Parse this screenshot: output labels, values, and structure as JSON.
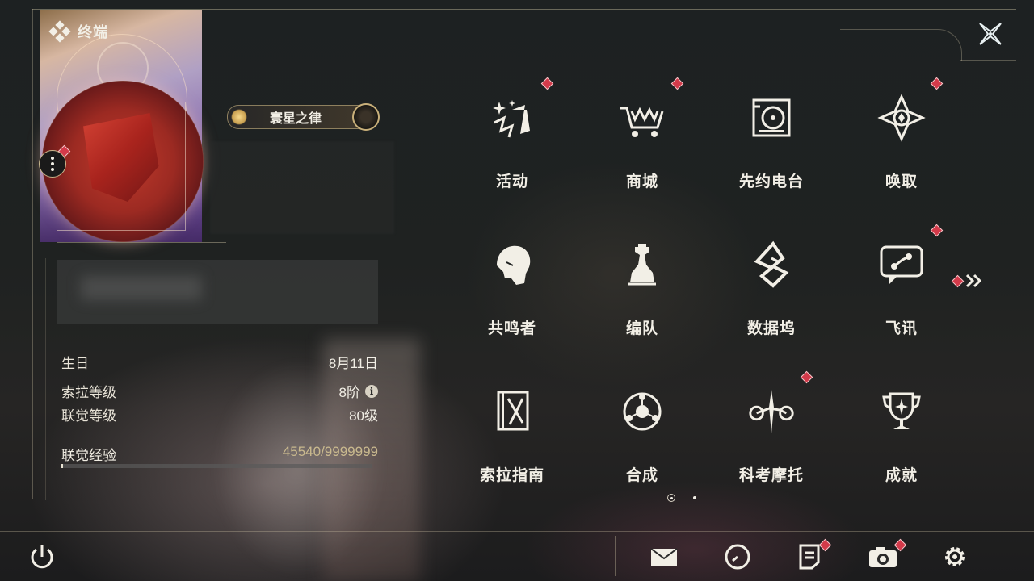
{
  "header": {
    "title": "终端"
  },
  "profile": {
    "title_badge": "寰星之律",
    "stats": [
      {
        "key": "生日",
        "value": "8月11日"
      },
      {
        "key": "索拉等级",
        "value": "8阶"
      },
      {
        "key": "联觉等级",
        "value": "80级"
      }
    ],
    "experience": {
      "label": "联觉经验",
      "value": "45540/9999999",
      "progress": 0.00455
    }
  },
  "menu": [
    {
      "label": "活动",
      "icon": "activity-icon",
      "badge": true
    },
    {
      "label": "商城",
      "icon": "shop-cart-icon",
      "badge": true
    },
    {
      "label": "先约电台",
      "icon": "radio-icon",
      "badge": false
    },
    {
      "label": "唤取",
      "icon": "summon-compass-icon",
      "badge": true
    },
    {
      "label": "共鸣者",
      "icon": "resonator-icon",
      "badge": false
    },
    {
      "label": "编队",
      "icon": "team-chess-icon",
      "badge": false
    },
    {
      "label": "数据坞",
      "icon": "data-dock-icon",
      "badge": false
    },
    {
      "label": "飞讯",
      "icon": "message-icon",
      "badge": true
    },
    {
      "label": "索拉指南",
      "icon": "guide-icon",
      "badge": false
    },
    {
      "label": "合成",
      "icon": "synthesis-icon",
      "badge": false
    },
    {
      "label": "科考摩托",
      "icon": "motorcycle-icon",
      "badge": true
    },
    {
      "label": "成就",
      "icon": "trophy-icon",
      "badge": false
    }
  ],
  "bottom_bar": [
    "power-icon",
    "mail-icon",
    "clock-icon",
    "notes-icon",
    "camera-icon",
    "settings-gear-icon"
  ],
  "colors": {
    "accent_gold": "#c9b98e",
    "badge_red": "#d33a4a",
    "text": "#f2efe6"
  }
}
